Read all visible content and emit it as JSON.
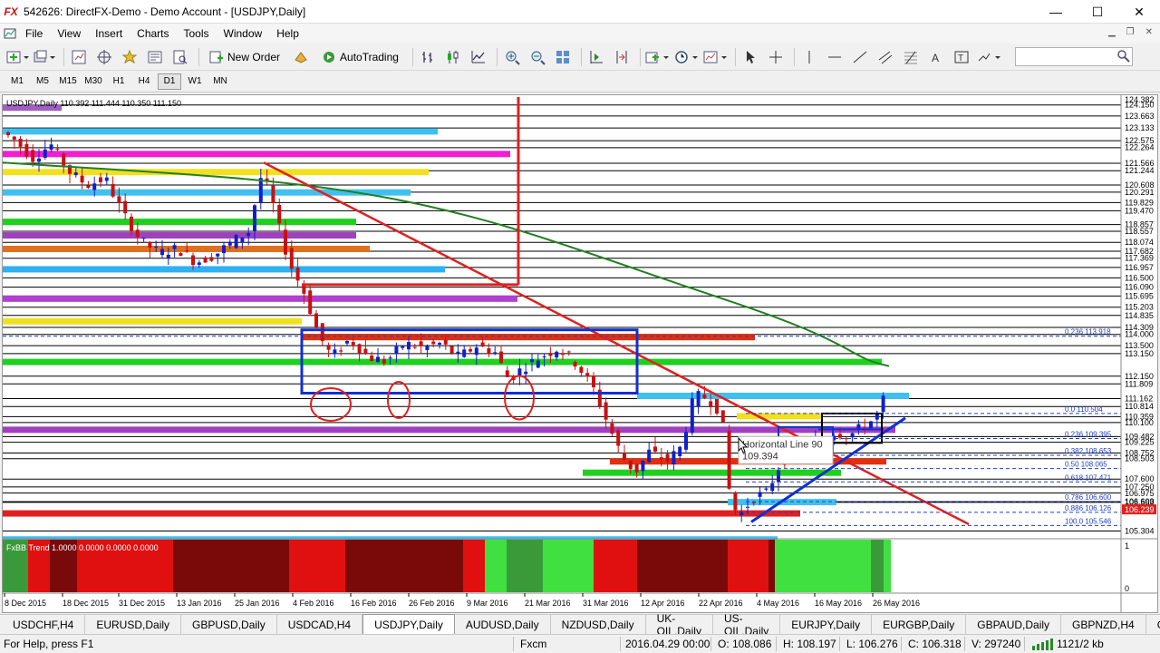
{
  "window": {
    "logo": "FX",
    "title": "542626: DirectFX-Demo - Demo Account - [USDJPY,Daily]",
    "controls": [
      "—",
      "☐",
      "✕"
    ]
  },
  "menu": [
    "File",
    "View",
    "Insert",
    "Charts",
    "Tools",
    "Window",
    "Help"
  ],
  "toolbar": {
    "new_order": "New Order",
    "autotrading": "AutoTrading"
  },
  "periods": [
    "M1",
    "M5",
    "M15",
    "M30",
    "H1",
    "H4",
    "D1",
    "W1",
    "MN"
  ],
  "active_period": "D1",
  "chart": {
    "info": "USDJPY,Daily  110.392 111.444 110.350 111.150",
    "indicator_label": "FxBB Trend 1.0000 0.0000 0.0000 0.0000",
    "tooltip_title": "Horizontal Line 90",
    "tooltip_value": "109.394",
    "current_price": "106.239",
    "price_labels": [
      "124.382",
      "124.150",
      "123.663",
      "123.133",
      "122.575",
      "122.264",
      "121.566",
      "121.244",
      "120.608",
      "120.291",
      "119.829",
      "119.470",
      "118.857",
      "118.557",
      "118.074",
      "117.682",
      "117.369",
      "116.957",
      "116.500",
      "116.090",
      "115.695",
      "115.203",
      "114.835",
      "114.309",
      "114.000",
      "113.500",
      "113.150",
      "112.150",
      "111.809",
      "111.162",
      "110.814",
      "110.359",
      "110.100",
      "109.482",
      "109.225",
      "108.752",
      "108.503",
      "107.600",
      "107.250",
      "106.975",
      "106.603",
      "106.569",
      "106.239",
      "105.304"
    ],
    "indicator_scale": [
      "1",
      "0"
    ],
    "fib_labels": [
      "0.236  113.918",
      "0.0  110.504",
      "0.236  109.395",
      "0.382  108.653",
      "0.50  108.065",
      "0.618  107.471",
      "0.786  106.600",
      "0.886  106.126",
      "100.0  105.546"
    ],
    "dates": [
      "8 Dec 2015",
      "18 Dec 2015",
      "31 Dec 2015",
      "13 Jan 2016",
      "25 Jan 2016",
      "4 Feb 2016",
      "16 Feb 2016",
      "26 Feb 2016",
      "9 Mar 2016",
      "21 Mar 2016",
      "31 Mar 2016",
      "12 Apr 2016",
      "22 Apr 2016",
      "4 May 2016",
      "16 May 2016",
      "26 May 2016"
    ]
  },
  "tabs": [
    "USDCHF,H4",
    "EURUSD,Daily",
    "GBPUSD,Daily",
    "USDCAD,H4",
    "USDJPY,Daily",
    "AUDUSD,Daily",
    "NZDUSD,Daily",
    "UK-OIL,Daily",
    "US-OIL,Daily",
    "EURJPY,Daily",
    "EURGBP,Daily",
    "GBPAUD,Daily",
    "GBPNZD,H4",
    "GBPJP"
  ],
  "active_tab": "USDJPY,Daily",
  "status": {
    "help": "For Help, press F1",
    "profile": "Fxcm",
    "datetime": "2016.04.29 00:00",
    "open": "O: 108.086",
    "high": "H: 108.197",
    "low": "L: 106.276",
    "close": "C: 106.318",
    "volume": "V: 297240",
    "traffic": "1121/2 kb"
  },
  "colors": {
    "bull_candle": "#1020c8",
    "bear_candle": "#c81010",
    "trendline": "#e02020",
    "ma": "#208020",
    "box": "#1030d0"
  }
}
